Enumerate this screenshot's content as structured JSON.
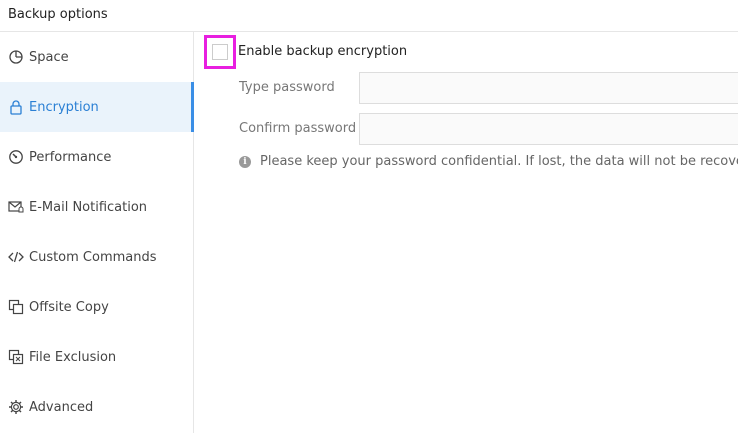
{
  "window": {
    "title": "Backup options"
  },
  "sidebar": {
    "items": [
      {
        "label": "Space",
        "icon": "pie-chart-icon",
        "active": false
      },
      {
        "label": "Encryption",
        "icon": "lock-icon",
        "active": true
      },
      {
        "label": "Performance",
        "icon": "speedometer-icon",
        "active": false
      },
      {
        "label": "E-Mail Notification",
        "icon": "mail-bell-icon",
        "active": false
      },
      {
        "label": "Custom Commands",
        "icon": "code-icon",
        "active": false
      },
      {
        "label": "Offsite Copy",
        "icon": "copy-icon",
        "active": false
      },
      {
        "label": "File Exclusion",
        "icon": "file-exclusion-icon",
        "active": false
      },
      {
        "label": "Advanced",
        "icon": "gear-icon",
        "active": false
      }
    ]
  },
  "encryption": {
    "enable_label": "Enable backup encryption",
    "enabled": false,
    "type_password_label": "Type password",
    "type_password_value": "",
    "confirm_password_label": "Confirm password",
    "confirm_password_value": "",
    "info_text": "Please keep your password confidential.  If lost, the data will not be recovered."
  },
  "colors": {
    "accent": "#3a8ee6",
    "active_bg": "#eaf3fb",
    "highlight_border": "#e81fe0"
  }
}
